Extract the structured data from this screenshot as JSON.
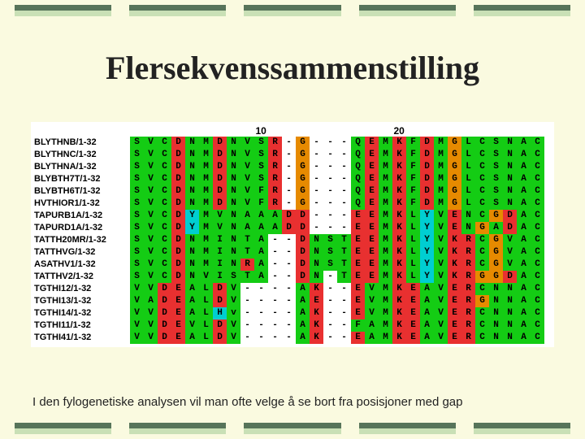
{
  "title": "Flersekvenssammenstilling",
  "caption": "I den fylogenetiske analysen vil man ofte velge å se bort fra posisjoner med gap",
  "ruler": {
    "ticks": [
      {
        "pos": 10,
        "label": "10"
      },
      {
        "pos": 20,
        "label": "20"
      }
    ]
  },
  "colors": {
    "S": "#14cc14",
    "T": "#14cc14",
    "N": "#14cc14",
    "Q": "#14cc14",
    "V": "#14cc14",
    "C": "#14cc14",
    "G": "#e68a00",
    "A": "#14cc14",
    "L": "#14cc14",
    "I": "#14cc14",
    "M": "#14cc14",
    "F": "#14cc14",
    "Y": "#00ced1",
    "H": "#00ced1",
    "D": "#e83030",
    "E": "#e83030",
    "K": "#e83030",
    "R": "#e83030",
    "P": "#d7d700",
    "-": "#ffffff",
    "v": "#14cc14"
  },
  "sequences": [
    {
      "name": "BLYTHNB/1-32",
      "seq": "SVCDNMDNVSR-G---QEMKFDMGLCSNAC"
    },
    {
      "name": "BLYTHNC/1-32",
      "seq": "SVCDNMDNVSR-G---QEMKFDMGLCSNAC"
    },
    {
      "name": "BLYTHNA/1-32",
      "seq": "SVCDNMDNVSR-G---QEMKFDMGLCSNAC"
    },
    {
      "name": "BLYBTH7T/1-32",
      "seq": "SVCDNMDNVSR-G---QEMKFDMGLCSNAC"
    },
    {
      "name": "BLYBTH6T/1-32",
      "seq": "SVCDNMDNVFR-G---QEMKFDMGLCSNAC"
    },
    {
      "name": "HVTHIOR1/1-32",
      "seq": "SVCDNMDNVFR-G---QEMKFDMGLCSNAC"
    },
    {
      "name": "TAPURB1A/1-32",
      "seq": "SVCDYMVNAAADD---EEMKLYVENCGDAC"
    },
    {
      "name": "TAPURD1A/1-32",
      "seq": "SVCDYMVNAAADD---EEMKLYVENGADAC"
    },
    {
      "name": "TATTH20MR/1-32",
      "seq": "SVCDNMINTA--DNSTEEMKLYVKRCGVAC"
    },
    {
      "name": "TATTHVG/1-32",
      "seq": "SVCDNMINTA--DNSTEEMKLYVKRCGVAC"
    },
    {
      "name": "ASATHV1/1-32",
      "seq": "SVCDNMINRA--DNSTEEMKLYVKRCGVAC"
    },
    {
      "name": "TATTHV2/1-32",
      "seq": "SVCDNVISTA--DN-TEEMKLYVKRGGDAC"
    },
    {
      "name": "TGTHI12/1-32",
      "seq": "VVDEALDV----AK--EVMKEAVERCNNAC"
    },
    {
      "name": "TGTHI13/1-32",
      "seq": "VADEALDV----AE--EVMKEAVERGNNAC"
    },
    {
      "name": "TGTHI14/1-32",
      "seq": "VVDEALHv----AK--EVMKEAVERCNNAC"
    },
    {
      "name": "TGTHI11/1-32",
      "seq": "VVDEVLDV----AK--FAMKEAVERCNNAC"
    },
    {
      "name": "TGTHI41/1-32",
      "seq": "VVDEALDV----AK--EAMKEAVERCNNAC"
    }
  ]
}
